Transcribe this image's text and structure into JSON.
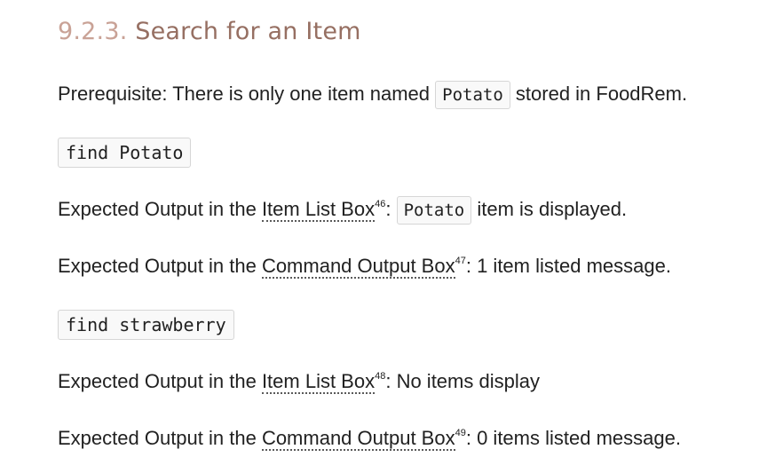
{
  "heading": {
    "number": "9.2.3.",
    "title": "Search for an Item"
  },
  "prerequisite": {
    "before": "Prerequisite: There is only one item named ",
    "code": "Potato",
    "after": " stored in FoodRem."
  },
  "command1": "find Potato",
  "expected1": {
    "before": "Expected Output in the ",
    "link": "Item List Box",
    "footnote": "46",
    "middle": ": ",
    "code": "Potato",
    "after": " item is displayed."
  },
  "expected2": {
    "before": "Expected Output in the ",
    "link": "Command Output Box",
    "footnote": "47",
    "after": ": 1 item listed message."
  },
  "command2": "find strawberry",
  "expected3": {
    "before": "Expected Output in the ",
    "link": "Item List Box",
    "footnote": "48",
    "after": ": No items display"
  },
  "expected4": {
    "before": "Expected Output in the ",
    "link": "Command Output Box",
    "footnote": "49",
    "after": ": 0 items listed message."
  }
}
